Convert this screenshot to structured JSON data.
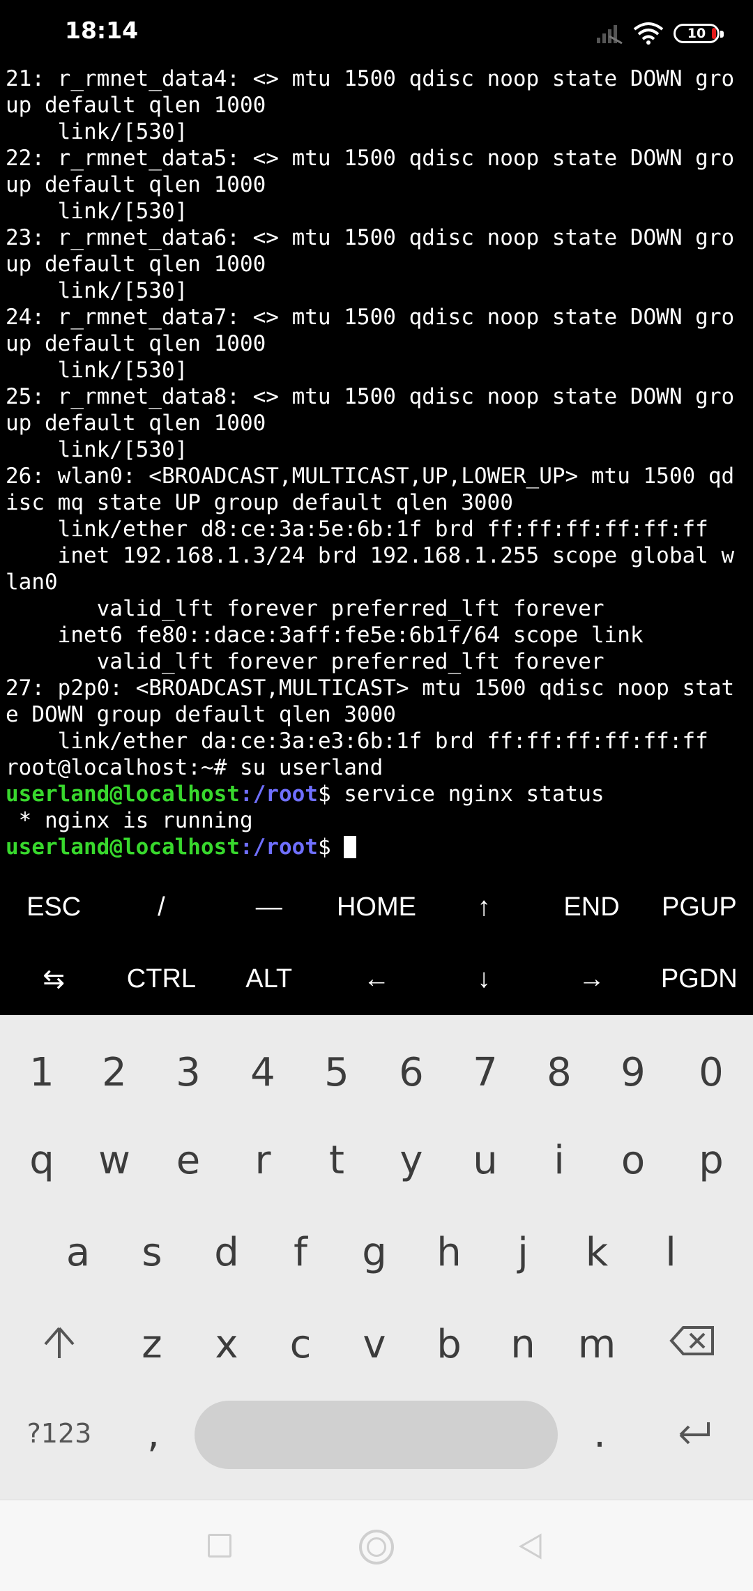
{
  "status_bar": {
    "time": "18:14",
    "battery": "10"
  },
  "terminal": {
    "lines": [
      "21: r_rmnet_data4: <> mtu 1500 qdisc noop state DOWN gro",
      "up default qlen 1000",
      "    link/[530]",
      "22: r_rmnet_data5: <> mtu 1500 qdisc noop state DOWN gro",
      "up default qlen 1000",
      "    link/[530]",
      "23: r_rmnet_data6: <> mtu 1500 qdisc noop state DOWN gro",
      "up default qlen 1000",
      "    link/[530]",
      "24: r_rmnet_data7: <> mtu 1500 qdisc noop state DOWN gro",
      "up default qlen 1000",
      "    link/[530]",
      "25: r_rmnet_data8: <> mtu 1500 qdisc noop state DOWN gro",
      "up default qlen 1000",
      "    link/[530]",
      "26: wlan0: <BROADCAST,MULTICAST,UP,LOWER_UP> mtu 1500 qd",
      "isc mq state UP group default qlen 3000",
      "    link/ether d8:ce:3a:5e:6b:1f brd ff:ff:ff:ff:ff:ff",
      "    inet 192.168.1.3/24 brd 192.168.1.255 scope global w",
      "lan0",
      "       valid_lft forever preferred_lft forever",
      "    inet6 fe80::dace:3aff:fe5e:6b1f/64 scope link",
      "       valid_lft forever preferred_lft forever",
      "27: p2p0: <BROADCAST,MULTICAST> mtu 1500 qdisc noop stat",
      "e DOWN group default qlen 3000",
      "    link/ether da:ce:3a:e3:6b:1f brd ff:ff:ff:ff:ff:ff",
      "root@localhost:~# su userland"
    ],
    "prompt1_user": "userland@localhost",
    "prompt1_path": ":/root",
    "prompt1_cmd": "$ service nginx status",
    "output_line": " * nginx is running",
    "prompt2_user": "userland@localhost",
    "prompt2_path": ":/root",
    "prompt2_sym": "$ "
  },
  "extra_keys": {
    "row1": [
      "ESC",
      "/",
      "—",
      "HOME",
      "↑",
      "END",
      "PGUP"
    ],
    "row2": [
      "⇆",
      "CTRL",
      "ALT",
      "←",
      "↓",
      "→",
      "PGDN"
    ]
  },
  "keyboard": {
    "numbers": [
      "1",
      "2",
      "3",
      "4",
      "5",
      "6",
      "7",
      "8",
      "9",
      "0"
    ],
    "row1": [
      "q",
      "w",
      "e",
      "r",
      "t",
      "y",
      "u",
      "i",
      "o",
      "p"
    ],
    "row2": [
      "a",
      "s",
      "d",
      "f",
      "g",
      "h",
      "j",
      "k",
      "l"
    ],
    "row3": [
      "z",
      "x",
      "c",
      "v",
      "b",
      "n",
      "m"
    ],
    "sym_label": "?123",
    "comma": ",",
    "period": "."
  },
  "colors": {
    "prompt_user": "#38d82d",
    "prompt_path": "#6f6fff",
    "keyboard_bg": "#ebebeb"
  }
}
